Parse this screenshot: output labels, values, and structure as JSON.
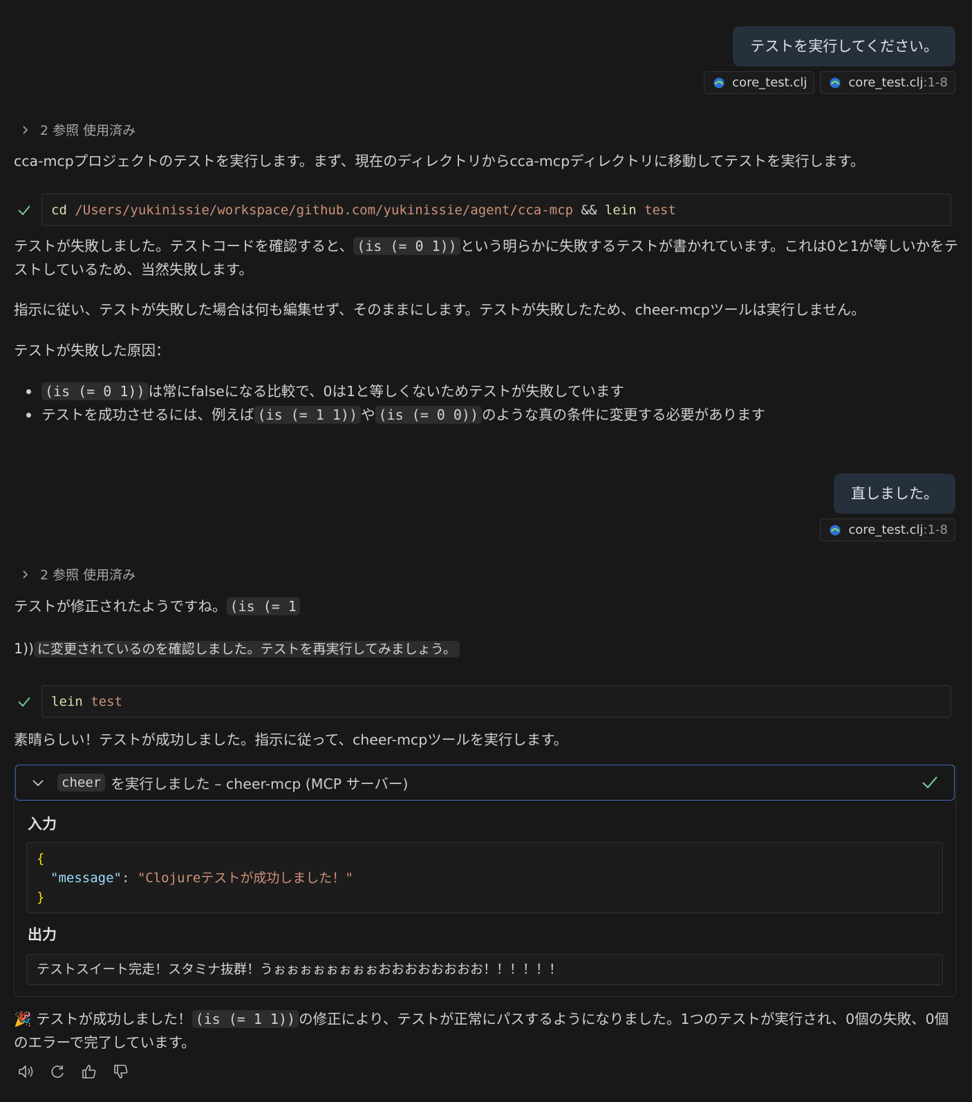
{
  "msg1": {
    "text": "テストを実行してください。",
    "chips": [
      {
        "name": "core_test.clj",
        "range": ""
      },
      {
        "name": "core_test.clj",
        "range": ":1-8"
      }
    ]
  },
  "refs_label": "2 参照 使用済み",
  "resp1": {
    "intro": "cca-mcpプロジェクトのテストを実行します。まず、現在のディレクトリからcca-mcpディレクトリに移動してテストを実行します。",
    "cmd": {
      "c1": "cd",
      "path": "/Users/yukinissie/workspace/github.com/yukinissie/agent/cca-mcp",
      "op": "&&",
      "c2": "lein",
      "arg": "test"
    },
    "p1a": "テストが失敗しました。テストコードを確認すると、",
    "p1code": "(is (= 0 1))",
    "p1b": "という明らかに失敗するテストが書かれています。これは0と1が等しいかをテストしているため、当然失敗します。",
    "p2": "指示に従い、テストが失敗した場合は何も編集せず、そのままにします。テストが失敗したため、cheer-mcpツールは実行しません。",
    "p3": "テストが失敗した原因：",
    "b1code": "(is (= 0 1))",
    "b1text": "は常にfalseになる比較で、0は1と等しくないためテストが失敗しています",
    "b2a": "テストを成功させるには、例えば",
    "b2code1": "(is (= 1 1))",
    "b2mid": "や",
    "b2code2": "(is (= 0 0))",
    "b2b": "のような真の条件に変更する必要があります"
  },
  "msg2": {
    "text": "直しました。",
    "chip": {
      "name": "core_test.clj",
      "range": ":1-8"
    }
  },
  "resp2": {
    "p1a": "テストが修正されたようですね。",
    "p1code": "(is (= 1",
    "p2a": "1))",
    "p2code": "に変更されているのを確認しました。テストを再実行してみましょう。",
    "cmd": {
      "c1": "lein",
      "arg": "test"
    },
    "p3": "素晴らしい！テストが成功しました。指示に従って、cheer-mcpツールを実行します。",
    "tool": {
      "name": "cheer",
      "title": "を実行しました – cheer-mcp (MCP サーバー)",
      "input_label": "入力",
      "json_open": "{",
      "json_key": "\"message\"",
      "json_colon": ": ",
      "json_value": "\"Clojureテストが成功しました！\"",
      "json_close": "}",
      "output_label": "出力",
      "output": "テストスイート完走！スタミナ抜群！うぉぉぉぉぉぉぉぉおおおおおおおお！！！！！！"
    },
    "final_emoji": "🎉",
    "final_a": "テストが成功しました！",
    "final_code": "(is (= 1 1))",
    "final_b": "の修正により、テストが正常にパスするようになりました。1つのテストが実行され、0個の失敗、0個のエラーで完了しています。"
  }
}
